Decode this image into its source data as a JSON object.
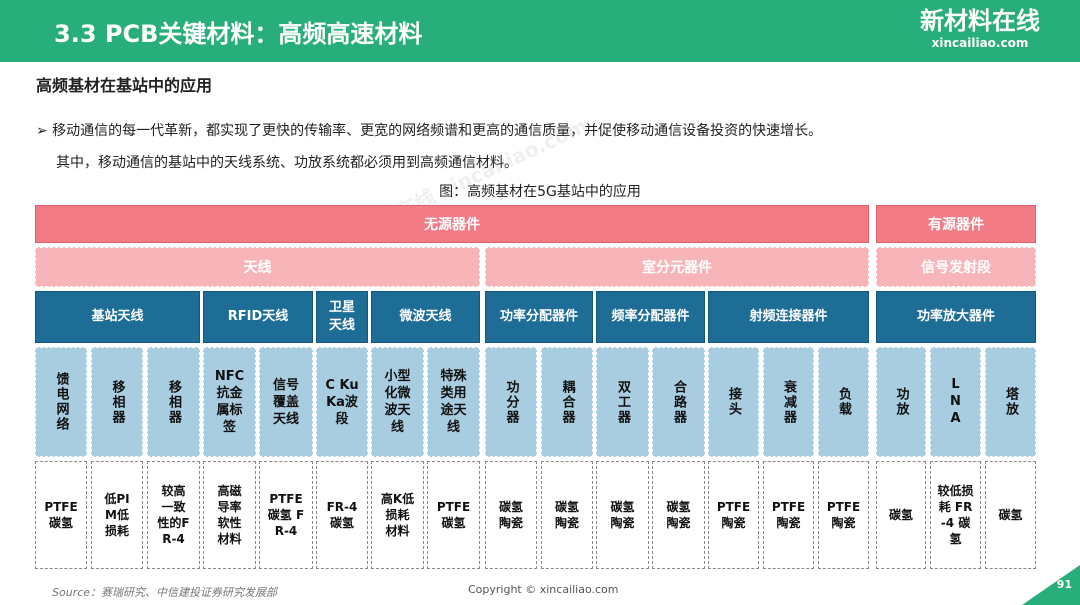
{
  "header": {
    "title": "3.3 PCB关键材料：高频高速材料",
    "logo_cn": "新材料在线",
    "logo_en": "xincailiao.com",
    "accent": "#27ae7a"
  },
  "subtitle": "高频基材在基站中的应用",
  "paragraphs": [
    "➢ 移动通信的每一代革新，都实现了更快的传输率、更宽的网络频谱和更高的通信质量，并促使移动通信设备投资的快速增长。",
    "其中，移动通信的基站中的天线系统、功放系统都必须用到高频通信材料。"
  ],
  "figure_caption": "图：高频基材在5G基站中的应用",
  "watermark": "新材料在线 xincailiao.com",
  "diagram": {
    "row1": [
      "无源器件",
      "有源器件"
    ],
    "row2": [
      "天线",
      "室分元器件",
      "信号发射段"
    ],
    "row3": [
      "基站天线",
      "RFID天线",
      "卫星天线",
      "微波天线",
      "功率分配器件",
      "频率分配器件",
      "射频连接器件",
      "功率放大器件"
    ],
    "row4": [
      "馈电网络",
      "移相器",
      "移相器",
      "NFC抗金属标签",
      "信号覆盖天线",
      "C Ku Ka波段",
      "小型化微波天线",
      "特殊类用途天线",
      "功分器",
      "耦合器",
      "双工器",
      "合路器",
      "接头",
      "衰减器",
      "负载",
      "功放",
      "LNA",
      "塔放"
    ],
    "row5": [
      "PTFE 碳氢",
      "低PIM低损耗",
      "较高一致性的FR-4",
      "高磁导率软性材料",
      "PTFE 碳氢 FR-4",
      "FR-4 碳氢",
      "高K低损耗材料",
      "PTFE 碳氢",
      "碳氢陶瓷",
      "碳氢陶瓷",
      "碳氢陶瓷",
      "碳氢陶瓷",
      "PTFE 陶瓷",
      "PTFE 陶瓷",
      "PTFE 陶瓷",
      "碳氢",
      "较低损耗 FR-4 碳氢",
      "碳氢"
    ]
  },
  "footer": {
    "source": "Source：赛瑞研究、中信建投证券研究发展部",
    "copyright": "Copyright © xincailiao.com",
    "page": "91"
  }
}
